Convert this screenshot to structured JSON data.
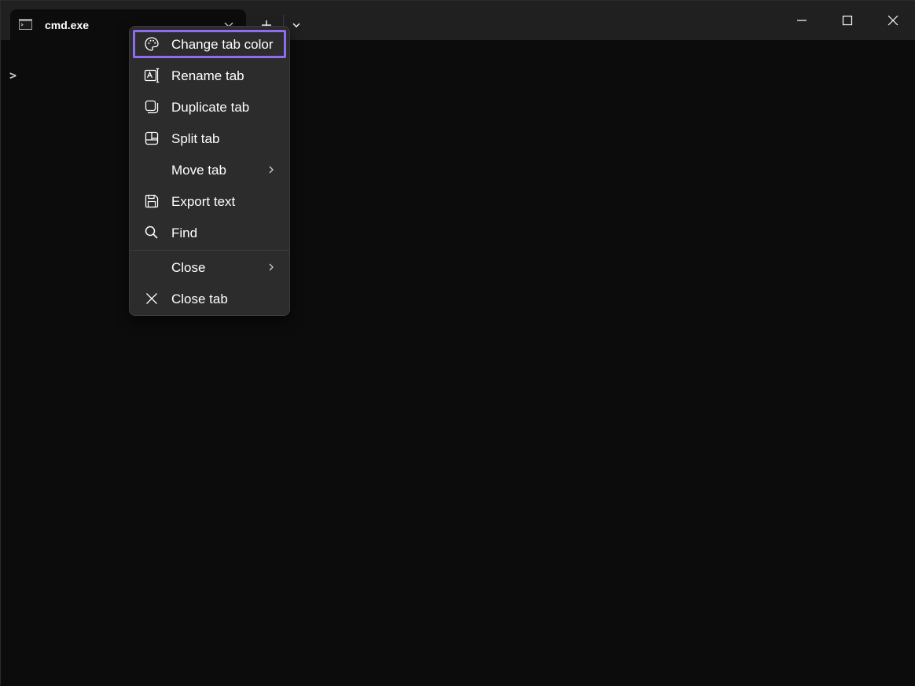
{
  "tab": {
    "title": "cmd.exe",
    "icon": "terminal-icon",
    "close_icon": "chevron-down-icon"
  },
  "toolbar": {
    "new_tab_icon": "plus-icon",
    "dropdown_icon": "chevron-down-icon"
  },
  "window_controls": {
    "minimize_icon": "minimize-icon",
    "maximize_icon": "maximize-icon",
    "close_icon": "close-icon"
  },
  "terminal": {
    "prompt": ">"
  },
  "context_menu": {
    "highlight_color": "#8e6cf0",
    "items": [
      {
        "label": "Change tab color",
        "icon": "palette-icon"
      },
      {
        "label": "Rename tab",
        "icon": "rename-icon"
      },
      {
        "label": "Duplicate tab",
        "icon": "duplicate-icon"
      },
      {
        "label": "Split tab",
        "icon": "split-icon"
      },
      {
        "label": "Move tab",
        "icon": "",
        "submenu": true
      },
      {
        "label": "Export text",
        "icon": "save-icon"
      },
      {
        "label": "Find",
        "icon": "search-icon"
      },
      {
        "label": "Close",
        "icon": "",
        "submenu": true
      },
      {
        "label": "Close tab",
        "icon": "close-icon"
      }
    ]
  }
}
